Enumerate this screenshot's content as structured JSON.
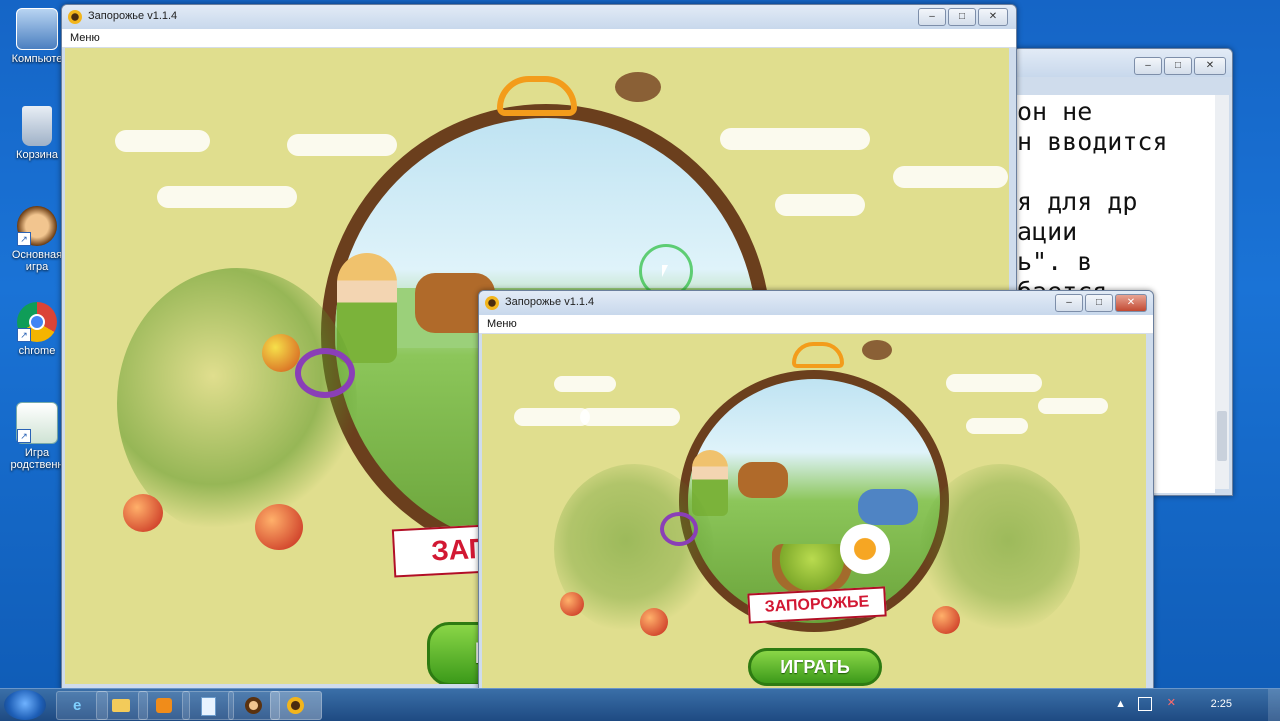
{
  "desktop": {
    "icons": [
      {
        "label": "Компьюте"
      },
      {
        "label": "Корзина"
      },
      {
        "label": "Основная игра"
      },
      {
        "label": "chrome"
      },
      {
        "label": "Игра родственн"
      }
    ]
  },
  "main_window": {
    "title": "Запорожье v1.1.4",
    "menu": "Меню",
    "banner": "ЗАП",
    "play_button": "И"
  },
  "small_window": {
    "title": "Запорожье v1.1.4",
    "menu": "Меню",
    "banner": "ЗАПОРОЖЬЕ",
    "play_button": "ИГРАТЬ"
  },
  "text_window": {
    "lines": [
      "он не",
      "н вводится",
      "",
      "я для др",
      "ации",
      "ь\". в",
      "бается"
    ]
  },
  "taskbar": {
    "time": "2:25"
  }
}
